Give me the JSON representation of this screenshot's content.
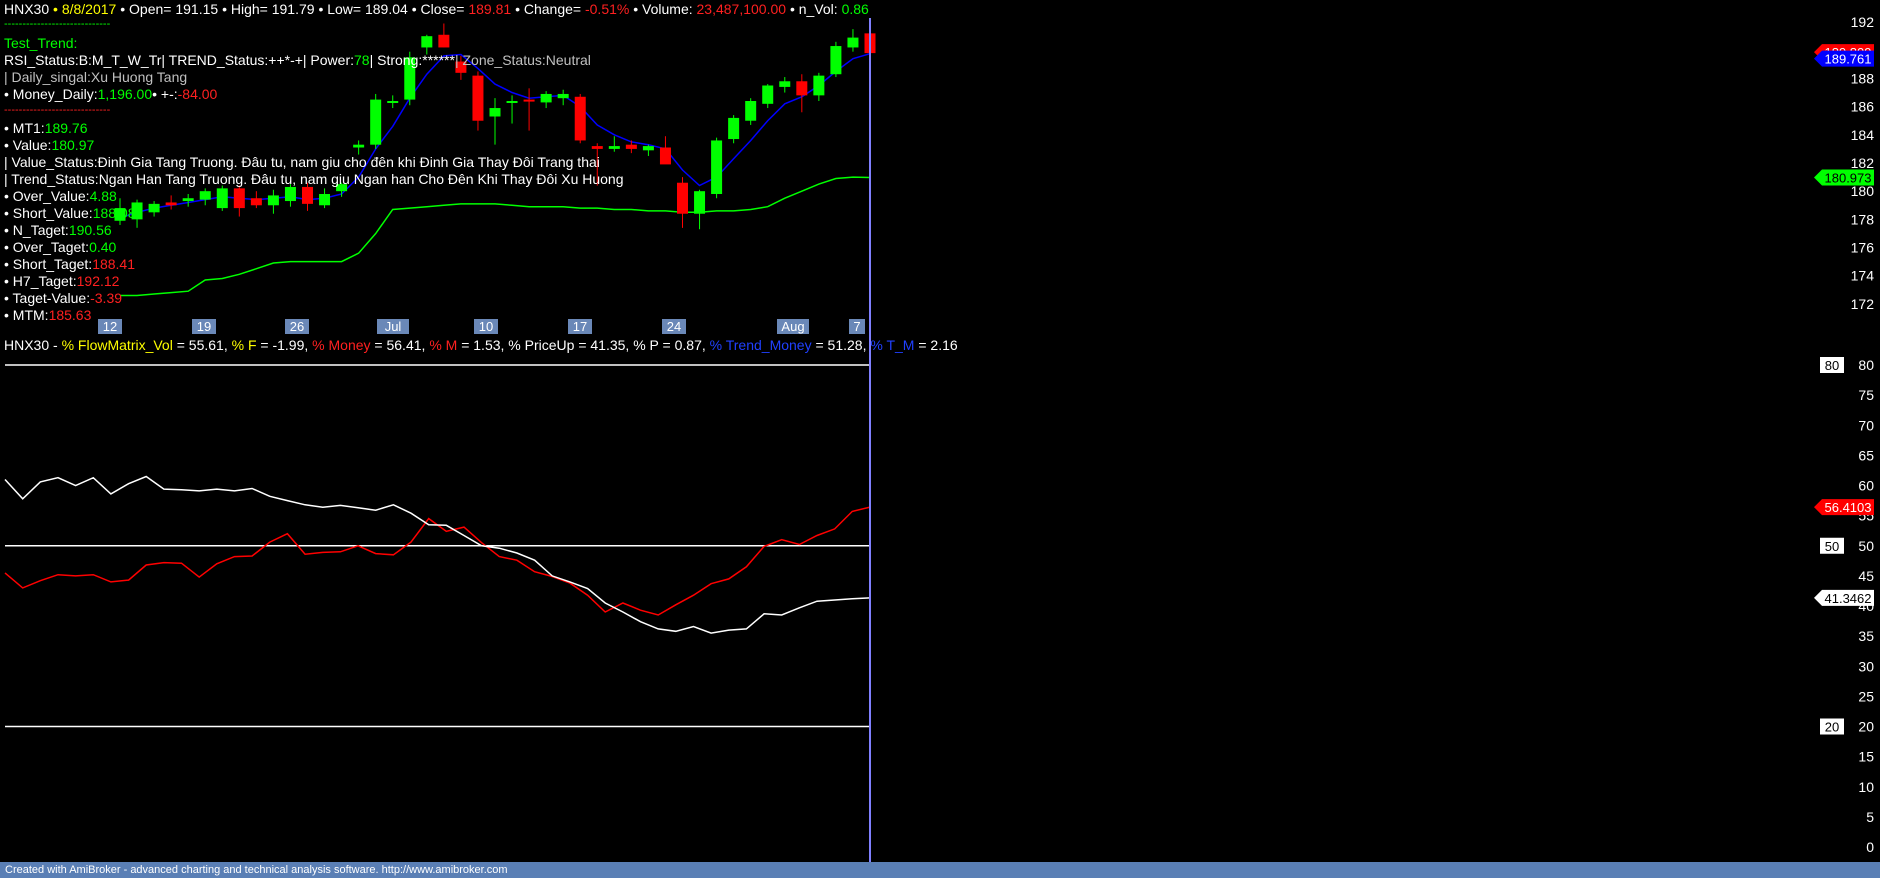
{
  "header": {
    "symbol": "HNX30",
    "date": "8/8/2017",
    "open_label": "Open=",
    "open": "191.15",
    "high_label": "High=",
    "high": "191.79",
    "low_label": "Low=",
    "low": "189.04",
    "close_label": "Close=",
    "close": "189.81",
    "change_label": "Change=",
    "change": "-0.51%",
    "volume_label": "Volume:",
    "volume": "23,487,100.00",
    "nvol_label": "n_Vol:",
    "nvol": "0.86"
  },
  "info": {
    "dash1": "-----------------------------",
    "test_trend": "Test_Trend:",
    "rsi_line": "RSI_Status:B:M_T_W_Tr| TREND_Status:++*-+| Power:",
    "power": "78",
    "strong_label": "| Strong:",
    "strong": "******",
    "zone": "| Zone_Status:Neutral",
    "daily_singal": "| Daily_singal:Xu Huong Tang",
    "money_daily_label": "• Money_Daily:",
    "money_daily": "1,196.00",
    "pm_label": "• +-:",
    "pm": "-84.00",
    "dash2": "-----------------------------",
    "mt1_label": "• MT1:",
    "mt1": "189.76",
    "value_label": "• Value:",
    "value": "180.97",
    "value_status": "| Value_Status:Đinh Gia Tang Truong. Đâu tu, nam giu cho đên khi Đinh Gia Thay Đôi Trang thai",
    "trend_status": "| Trend_Status:Ngan Han Tang Truong. Đâu tu, nam giu Ngan han Cho Đên Khi Thay Đôi Xu Huong",
    "over_value_label": "• Over_Value:",
    "over_value": "4.88",
    "short_value_label": "• Short_Value:",
    "short_value": "188.08",
    "n_taget_label": "• N_Taget:",
    "n_taget": "190.56",
    "over_taget_label": "• Over_Taget:",
    "over_taget": "0.40",
    "short_taget_label": "• Short_Taget:",
    "short_taget": "188.41",
    "h7_taget_label": "• H7_Taget:",
    "h7_taget": "192.12",
    "taget_value_label": "• Taget-Value:",
    "taget_value": "-3.39",
    "mtm_label": "• MTM:",
    "mtm": "185.63"
  },
  "lower_header": {
    "symbol": "HNX30 -",
    "flowmatrix_label": "% FlowMatrix_Vol",
    "flowmatrix": "= 55.61,",
    "f_label": "% F",
    "f": "= -1.99,",
    "money_label": "% Money",
    "money": "= 56.41,",
    "m_label": "% M",
    "m": "= 1.53,",
    "priceup_label": "% PriceUp",
    "priceup": "= 41.35,",
    "p_label": "% P",
    "p": "= 0.87,",
    "trend_money_label": "% Trend_Money",
    "trend_money": "= 51.28,",
    "tm_label": "% T_M",
    "tm": "= 2.16"
  },
  "footer": "Created with AmiBroker - advanced charting and technical analysis software. http://www.amibroker.com",
  "colors": {
    "up": "#00ff00",
    "down": "#ff0000",
    "ma": "#0000ff",
    "value_line": "#00ff00",
    "money": "#ff0000",
    "priceup": "#ffffff",
    "cursor": "#8080ff"
  },
  "chart_data": [
    {
      "type": "candlestick",
      "title": "HNX30",
      "x_labels": [
        "12",
        "19",
        "26",
        "Jul",
        "10",
        "17",
        "24",
        "Aug",
        "7"
      ],
      "ylim": [
        171,
        193
      ],
      "y_ticks": [
        172,
        174,
        176,
        178,
        180,
        182,
        184,
        186,
        188,
        190,
        192
      ],
      "candles": [
        {
          "o": 177.9,
          "h": 179.5,
          "l": 177.6,
          "c": 178.8
        },
        {
          "o": 178.0,
          "h": 179.4,
          "l": 177.4,
          "c": 179.2
        },
        {
          "o": 178.5,
          "h": 179.3,
          "l": 178.2,
          "c": 179.1
        },
        {
          "o": 179.2,
          "h": 179.7,
          "l": 178.7,
          "c": 179.0
        },
        {
          "o": 179.3,
          "h": 179.8,
          "l": 178.9,
          "c": 179.5
        },
        {
          "o": 179.4,
          "h": 180.2,
          "l": 179.0,
          "c": 180.0
        },
        {
          "o": 178.8,
          "h": 180.4,
          "l": 178.6,
          "c": 180.2
        },
        {
          "o": 180.2,
          "h": 180.4,
          "l": 178.2,
          "c": 178.8
        },
        {
          "o": 179.5,
          "h": 180.0,
          "l": 178.8,
          "c": 179.0
        },
        {
          "o": 179.0,
          "h": 180.1,
          "l": 178.4,
          "c": 179.7
        },
        {
          "o": 179.3,
          "h": 180.5,
          "l": 178.9,
          "c": 180.3
        },
        {
          "o": 180.3,
          "h": 180.6,
          "l": 178.6,
          "c": 179.1
        },
        {
          "o": 179.0,
          "h": 180.2,
          "l": 178.8,
          "c": 179.8
        },
        {
          "o": 180.0,
          "h": 180.6,
          "l": 179.6,
          "c": 180.5
        },
        {
          "o": 183.1,
          "h": 183.6,
          "l": 182.6,
          "c": 183.3
        },
        {
          "o": 183.3,
          "h": 186.9,
          "l": 183.0,
          "c": 186.5
        },
        {
          "o": 186.3,
          "h": 186.8,
          "l": 185.9,
          "c": 186.4
        },
        {
          "o": 186.5,
          "h": 189.9,
          "l": 186.1,
          "c": 189.5
        },
        {
          "o": 190.2,
          "h": 191.1,
          "l": 189.7,
          "c": 191.0
        },
        {
          "o": 191.1,
          "h": 191.9,
          "l": 190.2,
          "c": 190.2
        },
        {
          "o": 189.2,
          "h": 189.6,
          "l": 187.9,
          "c": 188.4
        },
        {
          "o": 188.2,
          "h": 188.5,
          "l": 184.3,
          "c": 185.0
        },
        {
          "o": 185.3,
          "h": 186.6,
          "l": 183.3,
          "c": 185.9
        },
        {
          "o": 186.3,
          "h": 186.8,
          "l": 184.8,
          "c": 186.4
        },
        {
          "o": 186.5,
          "h": 187.3,
          "l": 184.3,
          "c": 186.4
        },
        {
          "o": 186.3,
          "h": 187.1,
          "l": 185.9,
          "c": 186.9
        },
        {
          "o": 186.6,
          "h": 187.2,
          "l": 186.1,
          "c": 186.9
        },
        {
          "o": 186.7,
          "h": 186.9,
          "l": 183.4,
          "c": 183.6
        },
        {
          "o": 183.2,
          "h": 183.4,
          "l": 180.4,
          "c": 183.0
        },
        {
          "o": 183.0,
          "h": 183.9,
          "l": 182.8,
          "c": 183.2
        },
        {
          "o": 183.3,
          "h": 183.6,
          "l": 182.7,
          "c": 183.0
        },
        {
          "o": 182.9,
          "h": 183.3,
          "l": 182.5,
          "c": 183.2
        },
        {
          "o": 183.1,
          "h": 183.9,
          "l": 182.6,
          "c": 181.9
        },
        {
          "o": 180.6,
          "h": 181.0,
          "l": 177.4,
          "c": 178.4
        },
        {
          "o": 178.4,
          "h": 180.1,
          "l": 177.3,
          "c": 180.0
        },
        {
          "o": 179.8,
          "h": 183.8,
          "l": 179.5,
          "c": 183.6
        },
        {
          "o": 183.7,
          "h": 185.4,
          "l": 183.4,
          "c": 185.2
        },
        {
          "o": 185.0,
          "h": 186.6,
          "l": 184.7,
          "c": 186.4
        },
        {
          "o": 186.2,
          "h": 187.6,
          "l": 185.9,
          "c": 187.5
        },
        {
          "o": 187.4,
          "h": 188.1,
          "l": 187.0,
          "c": 187.8
        },
        {
          "o": 187.8,
          "h": 188.3,
          "l": 185.6,
          "c": 186.8
        },
        {
          "o": 186.8,
          "h": 188.4,
          "l": 186.4,
          "c": 188.2
        },
        {
          "o": 188.3,
          "h": 190.6,
          "l": 188.1,
          "c": 190.3
        },
        {
          "o": 190.2,
          "h": 191.5,
          "l": 189.9,
          "c": 190.9
        },
        {
          "o": 191.2,
          "h": 191.8,
          "l": 189.0,
          "c": 189.8
        }
      ],
      "series": [
        {
          "name": "MT1",
          "values": [
            178.1,
            178.5,
            178.8,
            179.0,
            179.2,
            179.4,
            179.6,
            179.5,
            179.4,
            179.5,
            179.6,
            179.4,
            179.5,
            179.8,
            181.0,
            183.0,
            184.6,
            186.6,
            188.3,
            189.6,
            189.7,
            188.7,
            187.6,
            187.0,
            186.6,
            186.7,
            186.8,
            186.0,
            184.7,
            184.0,
            183.5,
            183.3,
            183.0,
            181.5,
            180.4,
            181.0,
            182.3,
            183.6,
            185.0,
            186.2,
            186.7,
            187.5,
            188.5,
            189.4,
            189.76
          ]
        },
        {
          "name": "Value",
          "values": [
            172.6,
            172.6,
            172.7,
            172.8,
            172.9,
            173.7,
            173.8,
            174.1,
            174.5,
            174.9,
            175.0,
            175.0,
            175.0,
            175.0,
            175.6,
            177.0,
            178.7,
            178.8,
            178.9,
            179.0,
            179.1,
            179.1,
            179.1,
            179.0,
            178.9,
            178.9,
            178.9,
            178.8,
            178.8,
            178.7,
            178.7,
            178.6,
            178.6,
            178.5,
            178.5,
            178.6,
            178.6,
            178.7,
            178.9,
            179.5,
            180.0,
            180.5,
            180.9,
            181.0,
            180.97
          ]
        }
      ],
      "last_value_labels": [
        "189.809",
        "189.761",
        "180.973"
      ]
    },
    {
      "type": "line",
      "title": "HNX30",
      "ylim": [
        0,
        80
      ],
      "y_ticks": [
        0,
        5,
        10,
        15,
        20,
        25,
        30,
        35,
        40,
        45,
        50,
        55,
        60,
        65,
        70,
        75,
        80
      ],
      "hlines": [
        "80",
        "50",
        "20"
      ],
      "series": [
        {
          "name": "% Money",
          "values": [
            45.5,
            43.0,
            44.2,
            45.2,
            45.0,
            45.2,
            44.0,
            44.3,
            46.8,
            47.2,
            47.1,
            44.8,
            47.0,
            48.2,
            48.3,
            50.6,
            52.0,
            48.6,
            48.9,
            49.0,
            50.0,
            48.7,
            48.5,
            50.6,
            54.5,
            52.4,
            53.1,
            50.5,
            48.2,
            47.6,
            45.7,
            44.9,
            43.8,
            41.8,
            39.0,
            40.5,
            39.3,
            38.5,
            40.2,
            41.8,
            43.7,
            44.5,
            46.5,
            49.9,
            51.0,
            50.2,
            51.7,
            52.8,
            55.7,
            56.41
          ]
        },
        {
          "name": "% PriceUp",
          "values": [
            61.0,
            57.8,
            60.6,
            61.3,
            60.0,
            61.3,
            58.6,
            60.3,
            61.5,
            59.4,
            59.3,
            59.1,
            59.4,
            59.1,
            59.5,
            58.2,
            57.5,
            56.8,
            56.4,
            56.7,
            56.3,
            55.9,
            56.8,
            55.4,
            53.5,
            53.4,
            51.7,
            50.0,
            49.6,
            48.8,
            47.6,
            45.0,
            44.0,
            42.9,
            40.5,
            39.0,
            37.4,
            36.2,
            35.8,
            36.6,
            35.5,
            36.0,
            36.2,
            38.7,
            38.5,
            39.7,
            40.8,
            41.0,
            41.2,
            41.35
          ]
        }
      ],
      "last_value_labels": [
        "56.4103",
        "41.3462"
      ]
    }
  ]
}
